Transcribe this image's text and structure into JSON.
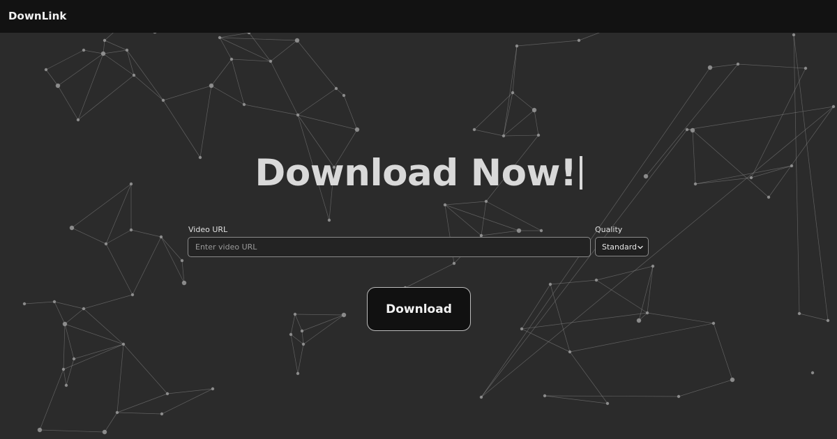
{
  "navbar": {
    "brand": "DownLink"
  },
  "hero": {
    "headline": "Download Now!"
  },
  "form": {
    "url_label": "Video URL",
    "url_placeholder": "Enter video URL",
    "url_value": "",
    "quality_label": "Quality",
    "quality_selected": "Standard",
    "download_label": "Download"
  },
  "icons": {
    "select_arrow": "chevron-down-icon"
  },
  "colors": {
    "background": "#2b2b2b",
    "navbar": "#121212",
    "network_lines": "#8c8c8c",
    "network_nodes": "#9a9a9a",
    "button_bg": "#111111"
  }
}
